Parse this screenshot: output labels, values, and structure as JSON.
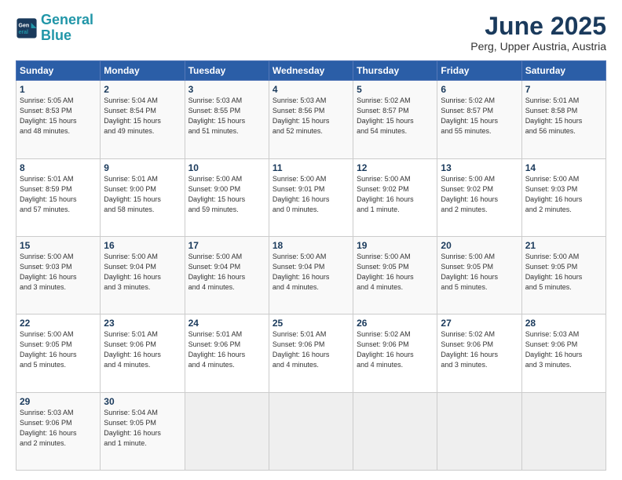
{
  "logo": {
    "line1": "General",
    "line2": "Blue"
  },
  "title": "June 2025",
  "subtitle": "Perg, Upper Austria, Austria",
  "days_of_week": [
    "Sunday",
    "Monday",
    "Tuesday",
    "Wednesday",
    "Thursday",
    "Friday",
    "Saturday"
  ],
  "weeks": [
    [
      {
        "day": "1",
        "info": "Sunrise: 5:05 AM\nSunset: 8:53 PM\nDaylight: 15 hours\nand 48 minutes."
      },
      {
        "day": "2",
        "info": "Sunrise: 5:04 AM\nSunset: 8:54 PM\nDaylight: 15 hours\nand 49 minutes."
      },
      {
        "day": "3",
        "info": "Sunrise: 5:03 AM\nSunset: 8:55 PM\nDaylight: 15 hours\nand 51 minutes."
      },
      {
        "day": "4",
        "info": "Sunrise: 5:03 AM\nSunset: 8:56 PM\nDaylight: 15 hours\nand 52 minutes."
      },
      {
        "day": "5",
        "info": "Sunrise: 5:02 AM\nSunset: 8:57 PM\nDaylight: 15 hours\nand 54 minutes."
      },
      {
        "day": "6",
        "info": "Sunrise: 5:02 AM\nSunset: 8:57 PM\nDaylight: 15 hours\nand 55 minutes."
      },
      {
        "day": "7",
        "info": "Sunrise: 5:01 AM\nSunset: 8:58 PM\nDaylight: 15 hours\nand 56 minutes."
      }
    ],
    [
      {
        "day": "8",
        "info": "Sunrise: 5:01 AM\nSunset: 8:59 PM\nDaylight: 15 hours\nand 57 minutes."
      },
      {
        "day": "9",
        "info": "Sunrise: 5:01 AM\nSunset: 9:00 PM\nDaylight: 15 hours\nand 58 minutes."
      },
      {
        "day": "10",
        "info": "Sunrise: 5:00 AM\nSunset: 9:00 PM\nDaylight: 15 hours\nand 59 minutes."
      },
      {
        "day": "11",
        "info": "Sunrise: 5:00 AM\nSunset: 9:01 PM\nDaylight: 16 hours\nand 0 minutes."
      },
      {
        "day": "12",
        "info": "Sunrise: 5:00 AM\nSunset: 9:02 PM\nDaylight: 16 hours\nand 1 minute."
      },
      {
        "day": "13",
        "info": "Sunrise: 5:00 AM\nSunset: 9:02 PM\nDaylight: 16 hours\nand 2 minutes."
      },
      {
        "day": "14",
        "info": "Sunrise: 5:00 AM\nSunset: 9:03 PM\nDaylight: 16 hours\nand 2 minutes."
      }
    ],
    [
      {
        "day": "15",
        "info": "Sunrise: 5:00 AM\nSunset: 9:03 PM\nDaylight: 16 hours\nand 3 minutes."
      },
      {
        "day": "16",
        "info": "Sunrise: 5:00 AM\nSunset: 9:04 PM\nDaylight: 16 hours\nand 3 minutes."
      },
      {
        "day": "17",
        "info": "Sunrise: 5:00 AM\nSunset: 9:04 PM\nDaylight: 16 hours\nand 4 minutes."
      },
      {
        "day": "18",
        "info": "Sunrise: 5:00 AM\nSunset: 9:04 PM\nDaylight: 16 hours\nand 4 minutes."
      },
      {
        "day": "19",
        "info": "Sunrise: 5:00 AM\nSunset: 9:05 PM\nDaylight: 16 hours\nand 4 minutes."
      },
      {
        "day": "20",
        "info": "Sunrise: 5:00 AM\nSunset: 9:05 PM\nDaylight: 16 hours\nand 5 minutes."
      },
      {
        "day": "21",
        "info": "Sunrise: 5:00 AM\nSunset: 9:05 PM\nDaylight: 16 hours\nand 5 minutes."
      }
    ],
    [
      {
        "day": "22",
        "info": "Sunrise: 5:00 AM\nSunset: 9:05 PM\nDaylight: 16 hours\nand 5 minutes."
      },
      {
        "day": "23",
        "info": "Sunrise: 5:01 AM\nSunset: 9:06 PM\nDaylight: 16 hours\nand 4 minutes."
      },
      {
        "day": "24",
        "info": "Sunrise: 5:01 AM\nSunset: 9:06 PM\nDaylight: 16 hours\nand 4 minutes."
      },
      {
        "day": "25",
        "info": "Sunrise: 5:01 AM\nSunset: 9:06 PM\nDaylight: 16 hours\nand 4 minutes."
      },
      {
        "day": "26",
        "info": "Sunrise: 5:02 AM\nSunset: 9:06 PM\nDaylight: 16 hours\nand 4 minutes."
      },
      {
        "day": "27",
        "info": "Sunrise: 5:02 AM\nSunset: 9:06 PM\nDaylight: 16 hours\nand 3 minutes."
      },
      {
        "day": "28",
        "info": "Sunrise: 5:03 AM\nSunset: 9:06 PM\nDaylight: 16 hours\nand 3 minutes."
      }
    ],
    [
      {
        "day": "29",
        "info": "Sunrise: 5:03 AM\nSunset: 9:06 PM\nDaylight: 16 hours\nand 2 minutes."
      },
      {
        "day": "30",
        "info": "Sunrise: 5:04 AM\nSunset: 9:05 PM\nDaylight: 16 hours\nand 1 minute."
      },
      {
        "day": "",
        "info": ""
      },
      {
        "day": "",
        "info": ""
      },
      {
        "day": "",
        "info": ""
      },
      {
        "day": "",
        "info": ""
      },
      {
        "day": "",
        "info": ""
      }
    ]
  ]
}
